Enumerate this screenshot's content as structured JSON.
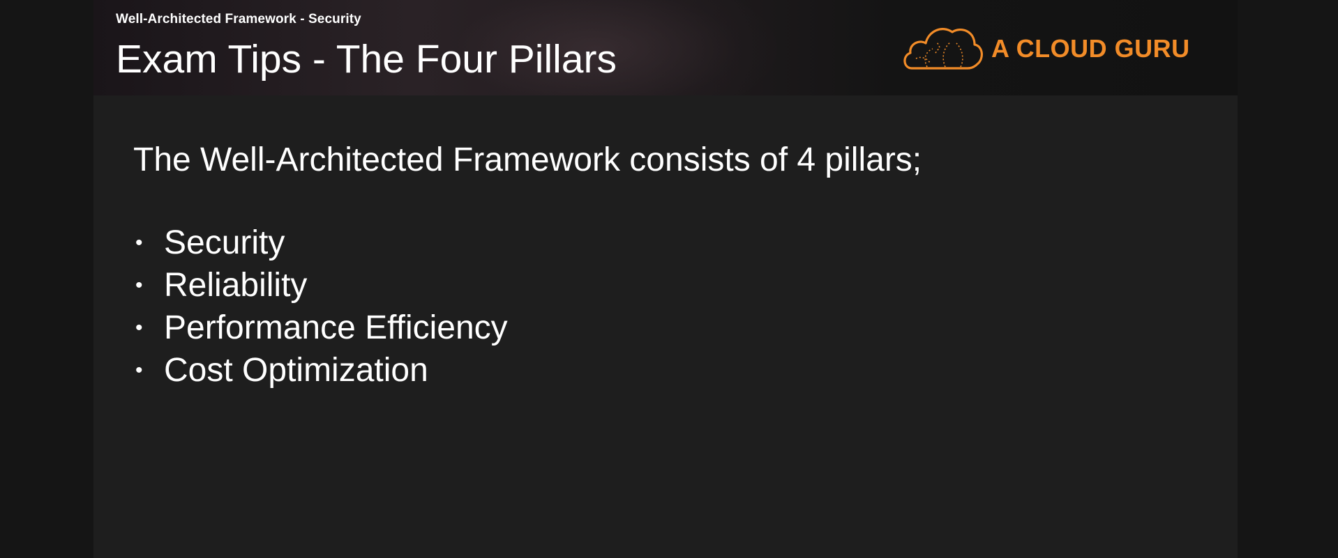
{
  "header": {
    "subtitle": "Well-Architected Framework - Security",
    "title": "Exam Tips - The Four Pillars"
  },
  "logo": {
    "icon": "cloud-icon",
    "text": "A CLOUD GURU",
    "color": "#f28c28"
  },
  "body": {
    "intro": "The Well-Architected Framework consists of 4 pillars;",
    "bullet_glyph": "•",
    "pillars": [
      "Security",
      "Reliability",
      "Performance Efficiency",
      "Cost Optimization"
    ]
  },
  "colors": {
    "slide_background": "#1e1e1e",
    "outer_background": "#151515",
    "text": "#ffffff",
    "accent": "#f28c28"
  }
}
